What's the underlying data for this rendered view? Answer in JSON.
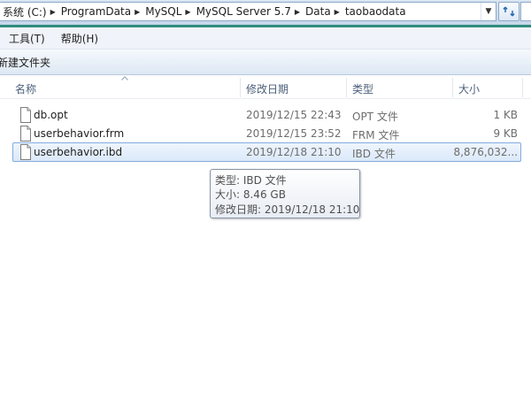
{
  "address_bar": {
    "crumbs": [
      "系统 (C:)",
      "ProgramData",
      "MySQL",
      "MySQL Server 5.7",
      "Data",
      "taobaodata"
    ],
    "dropdown_icon": "chevron-down-icon",
    "refresh_icon": "refresh-icon"
  },
  "menu": {
    "items": [
      "工具(T)",
      "帮助(H)"
    ]
  },
  "command_bar": {
    "new_folder": "新建文件夹"
  },
  "columns": {
    "name": "名称",
    "date": "修改日期",
    "type": "类型",
    "size": "大小",
    "sort": "ascending-by-name"
  },
  "files": [
    {
      "name": "db.opt",
      "date": "2019/12/15 22:43",
      "type": "OPT 文件",
      "size": "1 KB",
      "selected": false
    },
    {
      "name": "userbehavior.frm",
      "date": "2019/12/15 23:52",
      "type": "FRM 文件",
      "size": "9 KB",
      "selected": false
    },
    {
      "name": "userbehavior.ibd",
      "date": "2019/12/18 21:10",
      "type": "IBD 文件",
      "size": "8,876,032...",
      "selected": true
    }
  ],
  "tooltip": {
    "type_line": "类型: IBD 文件",
    "size_line": "大小: 8.46 GB",
    "date_line": "修改日期: 2019/12/18 21:10"
  },
  "colors": {
    "accent_line": "#2e8c7d",
    "selection_border": "#84acdd",
    "header_text": "#4c607a"
  }
}
